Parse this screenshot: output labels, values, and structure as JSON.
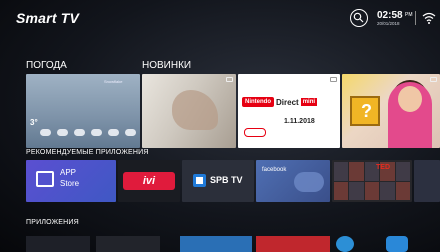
{
  "topbar": {
    "brand": "Smart TV",
    "time": "02:58",
    "ampm": "PM",
    "date": "20/01/2018"
  },
  "sections": {
    "weather_label": "ПОГОДА",
    "news_label": "НОВИНКИ",
    "recommended_label": "РЕКОМЕНДУЕМЫЕ ПРИЛОЖЕНИЯ",
    "apps_label": "ПРИЛОЖЕНИЯ"
  },
  "weather": {
    "title": "Snowflake",
    "temp": "3°"
  },
  "news": {
    "nintendo_brand": "Nintendo",
    "nintendo_title": "Direct",
    "nintendo_mini": "mini",
    "nintendo_date": "1.11.2018"
  },
  "recommended_apps": {
    "appstore_line1": "APP",
    "appstore_line2": "Store",
    "ivi": "ivi",
    "spb": "SPB TV",
    "facebook": "facebook",
    "ted": "TED"
  },
  "colors": {
    "accent_red": "#e60012",
    "appstore": "#4a55cc",
    "ivi": "#e01b3c",
    "facebook": "#4f6fb3"
  }
}
